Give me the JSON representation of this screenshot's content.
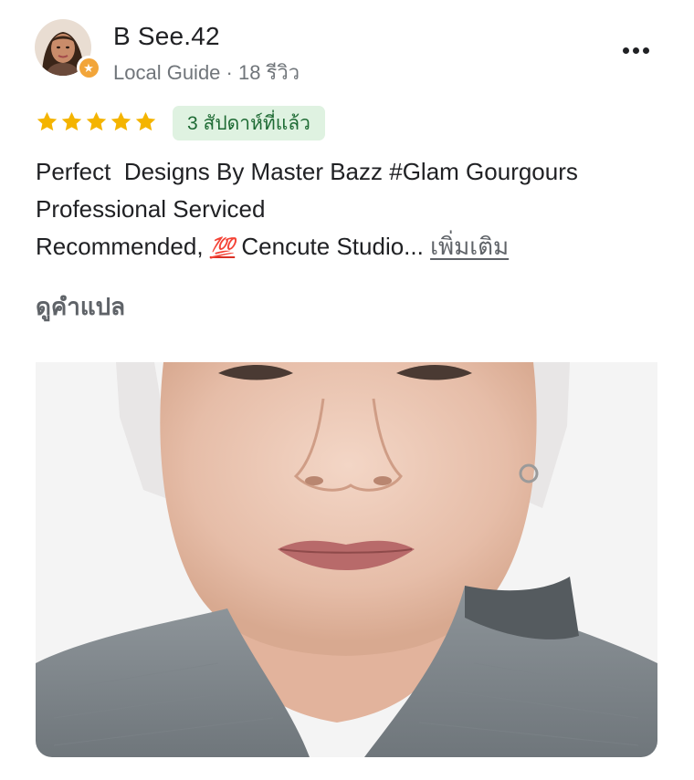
{
  "reviewer": {
    "name": "B See.42",
    "meta": "Local Guide · 18 รีวิว",
    "badge_icon": "local-guide-star-icon"
  },
  "menu": {
    "icon": "more-vertical-icon"
  },
  "rating": {
    "stars": 5,
    "max": 5,
    "star_color": "#f4b400"
  },
  "date_badge": "3 สัปดาห์ที่แล้ว",
  "review": {
    "line1": "Perfect  Designs By Master Bazz #Glam Gourgours",
    "line2": "Professional Serviced",
    "line3_prefix": "Recommended, ",
    "emoji": "💯",
    "line3_suffix": " Cencute Studio... ",
    "more_label": "เพิ่มเติม"
  },
  "translate_label": "ดูคำแปล",
  "colors": {
    "badge_bg": "#dff2e1",
    "badge_text": "#1e6b34",
    "meta_text": "#70757a"
  }
}
